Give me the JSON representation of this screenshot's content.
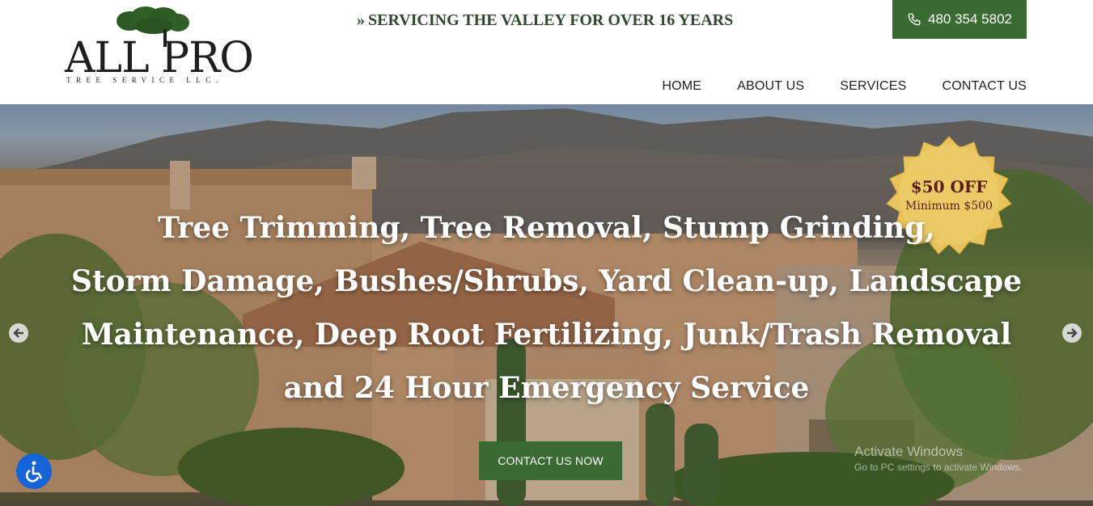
{
  "header": {
    "logo": {
      "main_text": "ALL PRO",
      "sub_text": "TREE SERVICE LLC."
    },
    "tagline": "SERVICING THE VALLEY FOR OVER 16 YEARS",
    "tagline_icon": "double-chevron-right-icon",
    "phone": {
      "icon": "phone-icon",
      "label": "480 354 5802"
    },
    "nav": [
      {
        "label": "HOME"
      },
      {
        "label": "ABOUT US"
      },
      {
        "label": "SERVICES"
      },
      {
        "label": "CONTACT US"
      }
    ]
  },
  "hero": {
    "headline_lines": [
      "Tree Trimming, Tree Removal, Stump Grinding,",
      "Storm Damage, Bushes/Shrubs, Yard Clean-up, Landscape",
      "Maintenance, Deep Root Fertilizing, Junk/Trash Removal",
      "and 24 Hour Emergency Service"
    ],
    "cta_label": "CONTACT US NOW",
    "badge": {
      "title": "$50 OFF",
      "subtitle": "Minimum $500"
    },
    "prev_icon": "arrow-left-icon",
    "next_icon": "arrow-right-icon"
  },
  "accessibility": {
    "icon": "wheelchair-icon"
  },
  "watermark": {
    "title": "Activate Windows",
    "subtitle": "Go to PC settings to activate Windows."
  },
  "colors": {
    "brand_green": "#3a6b32",
    "tagline_green": "#2f4a2c",
    "a11y_blue": "#1463d8",
    "badge_gold": "#e8c25a"
  }
}
